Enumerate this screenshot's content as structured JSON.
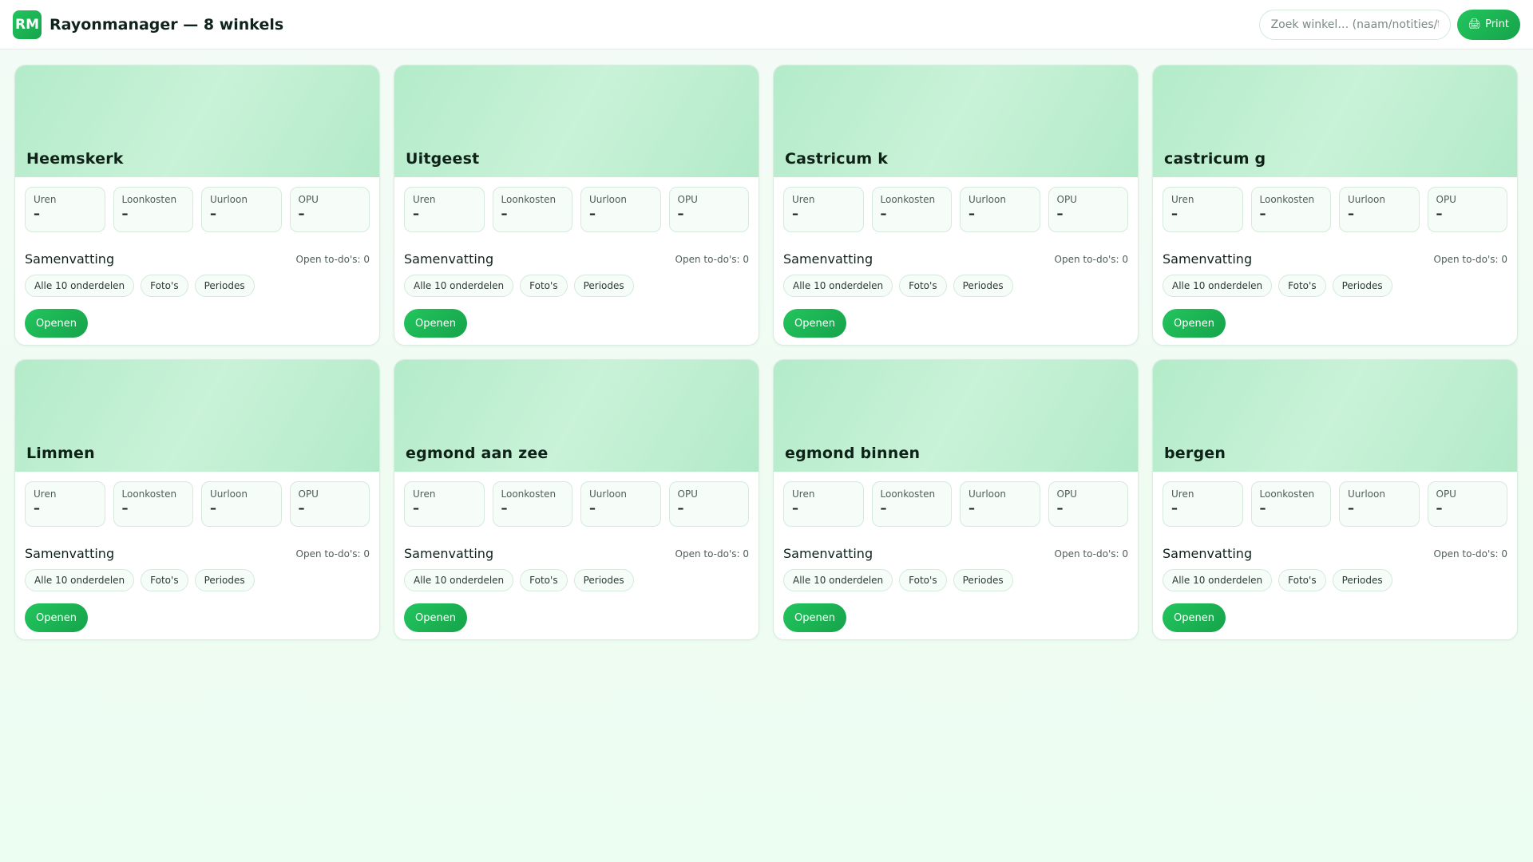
{
  "header": {
    "logo_text": "RM",
    "title": "Rayonmanager — 8 winkels",
    "search_placeholder": "Zoek winkel… (naam/notities/to-do's)",
    "print_label": "Print",
    "print_icon": "🖨"
  },
  "labels": {
    "metric_uren": "Uren",
    "metric_loonkosten": "Loonkosten",
    "metric_uurloon": "Uurloon",
    "metric_opu": "OPU",
    "summary_title": "Samenvatting",
    "chip_all": "Alle 10 onderdelen",
    "chip_photos": "Foto's",
    "chip_periods": "Periodes",
    "open_button": "Openen"
  },
  "colors": {
    "accent": "#22c55e",
    "accent_dark": "#16a34a",
    "card_header": "#b3ebc9"
  },
  "stores": [
    {
      "name": "Heemskerk",
      "uren": "–",
      "loonkosten": "–",
      "uurloon": "–",
      "opu": "–",
      "todos": "Open to-do's: 0"
    },
    {
      "name": "Uitgeest",
      "uren": "–",
      "loonkosten": "–",
      "uurloon": "–",
      "opu": "–",
      "todos": "Open to-do's: 0"
    },
    {
      "name": "Castricum k",
      "uren": "–",
      "loonkosten": "–",
      "uurloon": "–",
      "opu": "–",
      "todos": "Open to-do's: 0"
    },
    {
      "name": "castricum g",
      "uren": "–",
      "loonkosten": "–",
      "uurloon": "–",
      "opu": "–",
      "todos": "Open to-do's: 0"
    },
    {
      "name": "Limmen",
      "uren": "–",
      "loonkosten": "–",
      "uurloon": "–",
      "opu": "–",
      "todos": "Open to-do's: 0"
    },
    {
      "name": "egmond aan zee",
      "uren": "–",
      "loonkosten": "–",
      "uurloon": "–",
      "opu": "–",
      "todos": "Open to-do's: 0"
    },
    {
      "name": "egmond binnen",
      "uren": "–",
      "loonkosten": "–",
      "uurloon": "–",
      "opu": "–",
      "todos": "Open to-do's: 0"
    },
    {
      "name": "bergen",
      "uren": "–",
      "loonkosten": "–",
      "uurloon": "–",
      "opu": "–",
      "todos": "Open to-do's: 0"
    }
  ]
}
